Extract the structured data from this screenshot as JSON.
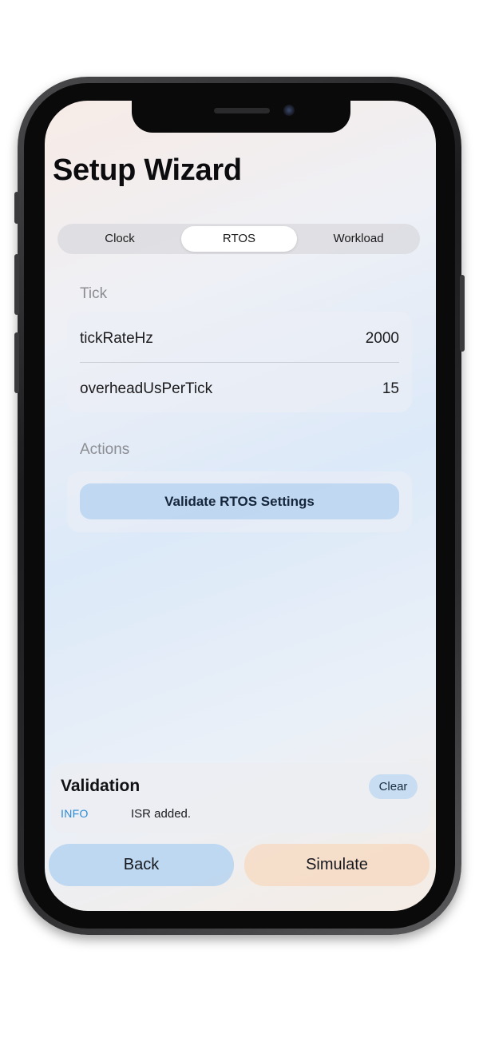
{
  "header": {
    "title": "Setup Wizard"
  },
  "tabs": [
    {
      "label": "Clock",
      "active": false
    },
    {
      "label": "RTOS",
      "active": true
    },
    {
      "label": "Workload",
      "active": false
    }
  ],
  "tick_section": {
    "label": "Tick",
    "rows": [
      {
        "label": "tickRateHz",
        "value": "2000"
      },
      {
        "label": "overheadUsPerTick",
        "value": "15"
      }
    ]
  },
  "actions_section": {
    "label": "Actions",
    "validate_label": "Validate RTOS Settings"
  },
  "validation": {
    "title": "Validation",
    "clear_label": "Clear",
    "log": [
      {
        "level": "INFO",
        "message": "ISR added."
      }
    ]
  },
  "footer": {
    "back_label": "Back",
    "simulate_label": "Simulate"
  },
  "colors": {
    "accent_info": "#2a8ad4",
    "back_button": "#bcd6f0",
    "simulate_button": "#f4dcc8"
  }
}
